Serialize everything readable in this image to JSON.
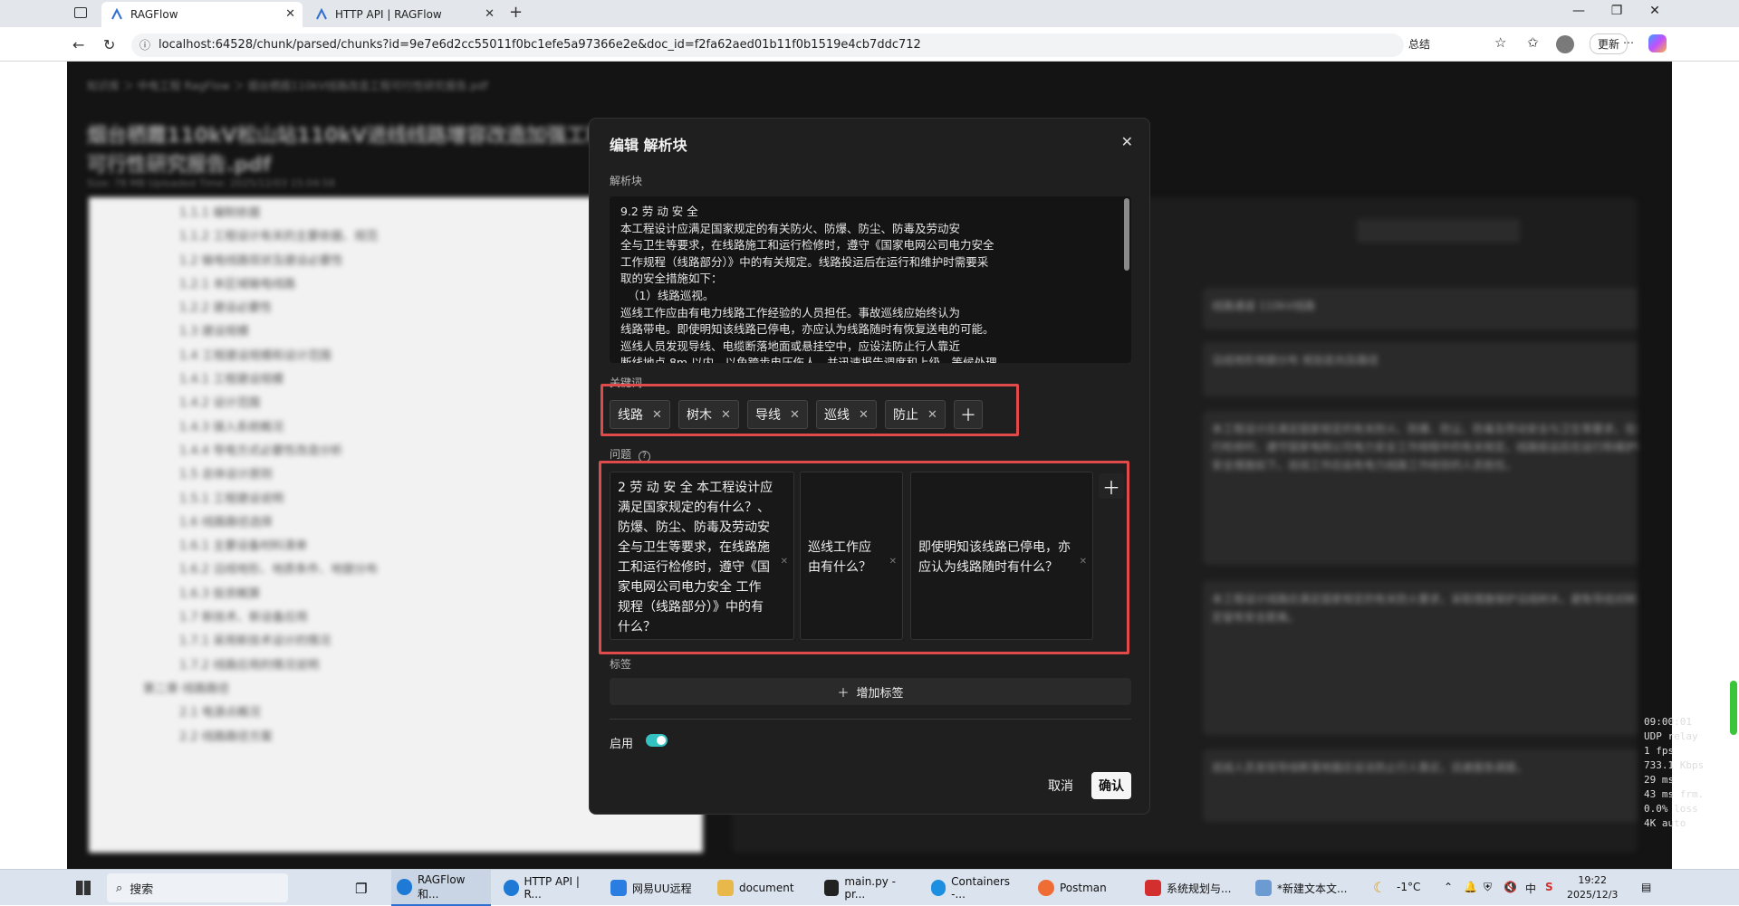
{
  "browser": {
    "tabs": [
      {
        "label": "RAGFlow",
        "active": true
      },
      {
        "label": "HTTP API | RAGFlow",
        "active": false
      }
    ],
    "new_tab": "+",
    "url": "localhost:64528/chunk/parsed/chunks?id=9e7e6d2cc55011f0bc1efe5a97366e2e&doc_id=f2fa62aed01b11f0b1519e4cb7ddc712",
    "summary_label": "总结",
    "update_label": "更新",
    "window_controls": [
      "—",
      "❐",
      "✕"
    ]
  },
  "modal": {
    "title": "编辑 解析块",
    "chunk_label": "解析块",
    "chunk_text": "9.2 劳 动 安 全\n本工程设计应满足国家规定的有关防火、防爆、防尘、防毒及劳动安\n全与卫生等要求，在线路施工和运行检修时，遵守《国家电网公司电力安全\n工作规程（线路部分）》中的有关规定。线路投运后在运行和维护时需要采\n取的安全措施如下：\n  （1）线路巡视。\n巡线工作应由有电力线路工作经验的人员担任。事故巡线应始终认为\n线路带电。即使明知该线路已停电，亦应认为线路随时有恢复送电的可能。\n巡线人员发现导线、电缆断落地面或悬挂空中，应设法防止行人靠近\n断线地点 8m 以内，以免跨步电压伤人，并迅速报告调度和上级，等候处理。",
    "keywords_label": "关键词",
    "keywords": [
      "线路",
      "树木",
      "导线",
      "巡线",
      "防止"
    ],
    "questions_label": "问题",
    "questions": [
      "2 劳 动 安 全 本工程设计应满足国家规定的有什么？、防爆、防尘、防毒及劳动安 全与卫生等要求，在线路施工和运行检修时，遵守《国家电网公司电力安全 工作规程（线路部分）》中的有什么？",
      "巡线工作应由有什么？",
      "即使明知该线路已停电，亦应认为线路随时有什么？"
    ],
    "tags_label": "标签",
    "add_tag_label": "增加标签",
    "enable_label": "启用",
    "enabled": true,
    "cancel_label": "取消",
    "confirm_label": "确认"
  },
  "overlay_stats": [
    "09:00:01",
    "UDP relay",
    "1 fps",
    "733.1 Kbps",
    "29 ms",
    "43 ms frm.",
    "0.0% loss",
    "4K auto"
  ],
  "taskbar": {
    "search_placeholder": "搜索",
    "apps": [
      {
        "label": "RAGFlow 和...",
        "active": true,
        "color": "#1f7ad6"
      },
      {
        "label": "HTTP API | R...",
        "active": false,
        "color": "#1f7ad6"
      },
      {
        "label": "网易UU远程",
        "active": false,
        "color": "#2a7de1"
      },
      {
        "label": "document",
        "active": false,
        "color": "#e8b84a"
      },
      {
        "label": "main.py - pr...",
        "active": false,
        "color": "#222222"
      },
      {
        "label": "Containers -...",
        "active": false,
        "color": "#1d8fe0"
      },
      {
        "label": "Postman",
        "active": false,
        "color": "#ef6c35"
      },
      {
        "label": "系统规划与...",
        "active": false,
        "color": "#d32f2f"
      },
      {
        "label": "*新建文本文...",
        "active": false,
        "color": "#6b9bd1"
      }
    ],
    "weather": "-1°C",
    "ime": "中",
    "time": "19:22",
    "date": "2025/12/3"
  }
}
